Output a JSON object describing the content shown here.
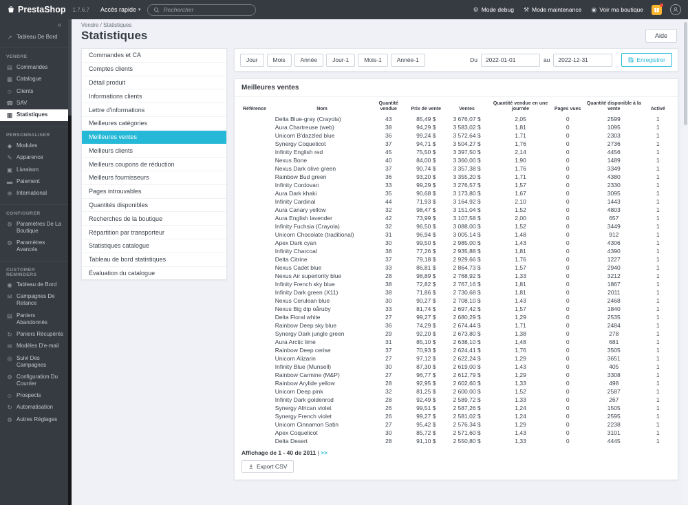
{
  "topbar": {
    "brand": "PrestaShop",
    "version": "1.7.6.7",
    "quick_access": "Accès rapide",
    "search_placeholder": "Rechercher",
    "links": [
      {
        "label": "Mode debug",
        "icon": "⚙",
        "icon_name": "bug"
      },
      {
        "label": "Mode maintenance",
        "icon": "⚒",
        "icon_name": "wrench"
      },
      {
        "label": "Voir ma boutique",
        "icon": "◉",
        "icon_name": "eye"
      }
    ]
  },
  "sidebar": {
    "collapse": "«",
    "sections": [
      {
        "title": "",
        "items": [
          {
            "label": "Tableau De Bord",
            "icon": "↗",
            "icon_name": "dashboard"
          }
        ]
      },
      {
        "title": "VENDRE",
        "items": [
          {
            "label": "Commandes",
            "icon": "▤",
            "icon_name": "orders"
          },
          {
            "label": "Catalogue",
            "icon": "▦",
            "icon_name": "catalog"
          },
          {
            "label": "Clients",
            "icon": "☺",
            "icon_name": "customers"
          },
          {
            "label": "SAV",
            "icon": "☎",
            "icon_name": "customer-service"
          },
          {
            "label": "Statistiques",
            "icon": "▥",
            "icon_name": "stats",
            "active": true
          }
        ]
      },
      {
        "title": "PERSONNALISER",
        "items": [
          {
            "label": "Modules",
            "icon": "◆",
            "icon_name": "modules"
          },
          {
            "label": "Apparence",
            "icon": "✎",
            "icon_name": "design"
          },
          {
            "label": "Livraison",
            "icon": "▣",
            "icon_name": "shipping"
          },
          {
            "label": "Paiement",
            "icon": "▬",
            "icon_name": "payment"
          },
          {
            "label": "International",
            "icon": "⊕",
            "icon_name": "international"
          }
        ]
      },
      {
        "title": "CONFIGURER",
        "items": [
          {
            "label": "Paramètres De La Boutique",
            "icon": "⚙",
            "icon_name": "shop-parameters"
          },
          {
            "label": "Paramètres Avancés",
            "icon": "⚙",
            "icon_name": "advanced-parameters"
          }
        ]
      },
      {
        "title": "CUSTOMER REMINDERS",
        "items": [
          {
            "label": "Tableau de Bord",
            "icon": "◉",
            "icon_name": "module-dashboard"
          },
          {
            "label": "Campagnes De Relance",
            "icon": "✉",
            "icon_name": "campaigns"
          },
          {
            "label": "Paniers Abandonnés",
            "icon": "▤",
            "icon_name": "abandoned-carts"
          },
          {
            "label": "Paniers Récupérés",
            "icon": "↻",
            "icon_name": "recovered-carts"
          },
          {
            "label": "Modèles D'e-mail",
            "icon": "✉",
            "icon_name": "email-templates"
          },
          {
            "label": "Suivi Des Campagnes",
            "icon": "◎",
            "icon_name": "campaign-tracking"
          },
          {
            "label": "Configuration Du Courrier",
            "icon": "⚙",
            "icon_name": "mail-configuration"
          },
          {
            "label": "Prospects",
            "icon": "☺",
            "icon_name": "prospects"
          },
          {
            "label": "Automatisation",
            "icon": "↻",
            "icon_name": "automation"
          },
          {
            "label": "Autres Réglages",
            "icon": "⚙",
            "icon_name": "other-settings"
          }
        ]
      }
    ]
  },
  "breadcrumb": {
    "parent": "Vendre",
    "separator": "/",
    "current": "Statistiques"
  },
  "page": {
    "title": "Statistiques",
    "help": "Aide"
  },
  "stats_menu": {
    "active": "Meilleures ventes",
    "items": [
      "Commandes et CA",
      "Comptes clients",
      "Détail produit",
      "Informations clients",
      "Lettre d'informations",
      "Meilleures catégories",
      "Meilleures ventes",
      "Meilleurs clients",
      "Meilleurs coupons de réduction",
      "Meilleurs fournisseurs",
      "Pages introuvables",
      "Quantités disponibles",
      "Recherches de la boutique",
      "Répartition par transporteur",
      "Statistiques catalogue",
      "Tableau de bord statistiques",
      "Évaluation du catalogue"
    ]
  },
  "filters": {
    "periods": [
      "Jour",
      "Mois",
      "Année",
      "Jour-1",
      "Mois-1",
      "Année-1"
    ],
    "from_label": "Du",
    "from_value": "2022-01-01",
    "to_label": "au",
    "to_value": "2022-12-31",
    "save": "Enregistrer"
  },
  "table": {
    "title": "Meilleures ventes",
    "columns": [
      "Référence",
      "Nom",
      "Quantité vendue",
      "Prix de vente",
      "Ventes",
      "Quantité vendue en une journée",
      "Pages vues",
      "Quantité disponible à la vente",
      "Activé"
    ],
    "rows": [
      [
        "Delta Blue-gray (Crayola)",
        "43",
        "85,49 $",
        "3 676,07 $",
        "2,05",
        "0",
        "2599",
        "1"
      ],
      [
        "Aura Chartreuse (web)",
        "38",
        "94,29 $",
        "3 583,02 $",
        "1,81",
        "0",
        "1095",
        "1"
      ],
      [
        "Unicorn B'dazzled blue",
        "36",
        "99,24 $",
        "3 572,64 $",
        "1,71",
        "0",
        "2303",
        "1"
      ],
      [
        "Synergy Coquelicot",
        "37",
        "94,71 $",
        "3 504,27 $",
        "1,76",
        "0",
        "2736",
        "1"
      ],
      [
        "Infinity English red",
        "45",
        "75,50 $",
        "3 397,50 $",
        "2,14",
        "0",
        "4456",
        "1"
      ],
      [
        "Nexus Bone",
        "40",
        "84,00 $",
        "3 360,00 $",
        "1,90",
        "0",
        "1489",
        "1"
      ],
      [
        "Nexus Dark olive green",
        "37",
        "90,74 $",
        "3 357,38 $",
        "1,76",
        "0",
        "3349",
        "1"
      ],
      [
        "Rainbow Bud green",
        "36",
        "93,20 $",
        "3 355,20 $",
        "1,71",
        "0",
        "4380",
        "1"
      ],
      [
        "Infinity Cordovan",
        "33",
        "99,29 $",
        "3 276,57 $",
        "1,57",
        "0",
        "2330",
        "1"
      ],
      [
        "Aura Dark khaki",
        "35",
        "90,68 $",
        "3 173,80 $",
        "1,67",
        "0",
        "3095",
        "1"
      ],
      [
        "Infinity Cardinal",
        "44",
        "71,93 $",
        "3 164,92 $",
        "2,10",
        "0",
        "1443",
        "1"
      ],
      [
        "Aura Canary yellow",
        "32",
        "98,47 $",
        "3 151,04 $",
        "1,52",
        "0",
        "4803",
        "1"
      ],
      [
        "Aura English lavender",
        "42",
        "73,99 $",
        "3 107,58 $",
        "2,00",
        "0",
        "657",
        "1"
      ],
      [
        "Infinity Fuchsia (Crayola)",
        "32",
        "96,50 $",
        "3 088,00 $",
        "1,52",
        "0",
        "3449",
        "1"
      ],
      [
        "Unicorn Chocolate (traditional)",
        "31",
        "96,94 $",
        "3 005,14 $",
        "1,48",
        "0",
        "912",
        "1"
      ],
      [
        "Apex Dark cyan",
        "30",
        "99,50 $",
        "2 985,00 $",
        "1,43",
        "0",
        "4306",
        "1"
      ],
      [
        "Infinity Charcoal",
        "38",
        "77,26 $",
        "2 935,88 $",
        "1,81",
        "0",
        "4390",
        "1"
      ],
      [
        "Delta Citrine",
        "37",
        "79,18 $",
        "2 929,66 $",
        "1,76",
        "0",
        "1227",
        "1"
      ],
      [
        "Nexus Cadet blue",
        "33",
        "86,81 $",
        "2 864,73 $",
        "1,57",
        "0",
        "2940",
        "1"
      ],
      [
        "Nexus Air superiority blue",
        "28",
        "98,89 $",
        "2 768,92 $",
        "1,33",
        "0",
        "3212",
        "1"
      ],
      [
        "Infinity French sky blue",
        "38",
        "72,82 $",
        "2 767,16 $",
        "1,81",
        "0",
        "1867",
        "1"
      ],
      [
        "Infinity Dark green (X11)",
        "38",
        "71,86 $",
        "2 730,68 $",
        "1,81",
        "0",
        "2011",
        "1"
      ],
      [
        "Nexus Cerulean blue",
        "30",
        "90,27 $",
        "2 708,10 $",
        "1,43",
        "0",
        "2468",
        "1"
      ],
      [
        "Nexus Big dip oåruby",
        "33",
        "81,74 $",
        "2 697,42 $",
        "1,57",
        "0",
        "1840",
        "1"
      ],
      [
        "Delta Floral white",
        "27",
        "99,27 $",
        "2 680,29 $",
        "1,29",
        "0",
        "2535",
        "1"
      ],
      [
        "Rainbow Deep sky blue",
        "36",
        "74,29 $",
        "2 674,44 $",
        "1,71",
        "0",
        "2484",
        "1"
      ],
      [
        "Synergy Dark jungle green",
        "29",
        "92,20 $",
        "2 673,80 $",
        "1,38",
        "0",
        "278",
        "1"
      ],
      [
        "Aura Arctic lime",
        "31",
        "85,10 $",
        "2 638,10 $",
        "1,48",
        "0",
        "681",
        "1"
      ],
      [
        "Rainbow Deep cerise",
        "37",
        "70,93 $",
        "2 624,41 $",
        "1,76",
        "0",
        "3505",
        "1"
      ],
      [
        "Unicorn Alizarin",
        "27",
        "97,12 $",
        "2 622,24 $",
        "1,29",
        "0",
        "3651",
        "1"
      ],
      [
        "Infinity Blue (Munsell)",
        "30",
        "87,30 $",
        "2 619,00 $",
        "1,43",
        "0",
        "405",
        "1"
      ],
      [
        "Rainbow Carmine (M&P)",
        "27",
        "96,77 $",
        "2 612,79 $",
        "1,29",
        "0",
        "3308",
        "1"
      ],
      [
        "Rainbow Arylide yellow",
        "28",
        "92,95 $",
        "2 602,60 $",
        "1,33",
        "0",
        "498",
        "1"
      ],
      [
        "Unicorn Deep pink",
        "32",
        "81,25 $",
        "2 600,00 $",
        "1,52",
        "0",
        "2587",
        "1"
      ],
      [
        "Infinity Dark goldenrod",
        "28",
        "92,49 $",
        "2 589,72 $",
        "1,33",
        "0",
        "267",
        "1"
      ],
      [
        "Synergy African violet",
        "26",
        "99,51 $",
        "2 587,26 $",
        "1,24",
        "0",
        "1505",
        "1"
      ],
      [
        "Synergy French violet",
        "26",
        "99,27 $",
        "2 581,02 $",
        "1,24",
        "0",
        "2595",
        "1"
      ],
      [
        "Unicorn Cinnamon Satin",
        "27",
        "95,42 $",
        "2 576,34 $",
        "1,29",
        "0",
        "2238",
        "1"
      ],
      [
        "Apex Coquelicot",
        "30",
        "85,72 $",
        "2 571,60 $",
        "1,43",
        "0",
        "3101",
        "1"
      ],
      [
        "Delta Desert",
        "28",
        "91,10 $",
        "2 550,80 $",
        "1,33",
        "0",
        "4445",
        "1"
      ]
    ],
    "pagination": {
      "text": "Affichage de 1 - 40 de 2011",
      "separator": "|",
      "next": ">>"
    },
    "export": "Export CSV"
  },
  "colors": {
    "accent": "#25b9d7",
    "topbar": "#363a41",
    "notification": "#fbb52f"
  }
}
